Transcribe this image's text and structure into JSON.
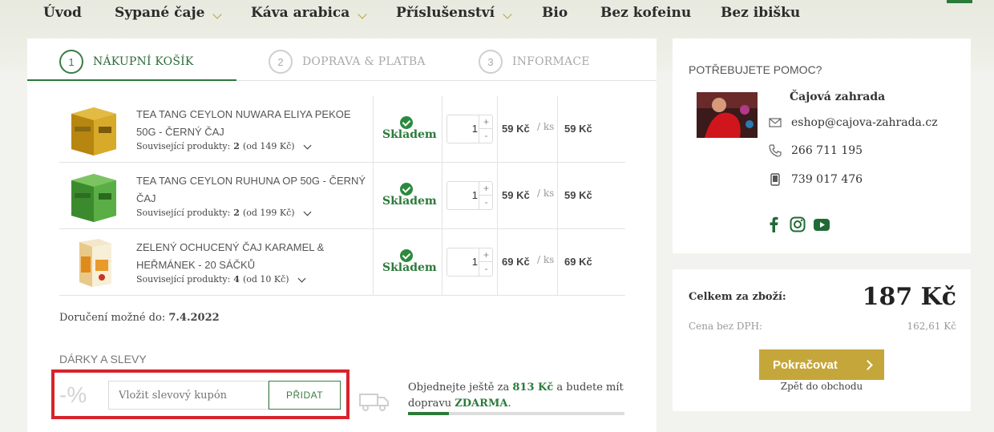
{
  "nav": {
    "items": [
      {
        "label": "Úvod",
        "has_menu": false
      },
      {
        "label": "Sypané čaje",
        "has_menu": true
      },
      {
        "label": "Káva arabica",
        "has_menu": true
      },
      {
        "label": "Příslušenství",
        "has_menu": true
      },
      {
        "label": "Bio",
        "has_menu": false
      },
      {
        "label": "Bez kofeinu",
        "has_menu": false
      },
      {
        "label": "Bez ibišku",
        "has_menu": false
      }
    ]
  },
  "steps": [
    {
      "num": "1",
      "label": "NÁKUPNÍ KOŠÍK",
      "active": true
    },
    {
      "num": "2",
      "label": "DOPRAVA & PLATBA",
      "active": false
    },
    {
      "num": "3",
      "label": "INFORMACE",
      "active": false
    }
  ],
  "cart": {
    "items": [
      {
        "name": "TEA TANG CEYLON NUWARA ELIYA PEKOE 50G - ČERNÝ ČAJ",
        "related_label": "Související produkty:",
        "related_count": "2",
        "related_from": "(od 149 Kč)",
        "stock": "Skladem",
        "qty": "1",
        "price": "59 Kč",
        "unit": "/ ks",
        "total": "59 Kč"
      },
      {
        "name": "TEA TANG CEYLON RUHUNA OP 50G - ČERNÝ ČAJ",
        "related_label": "Související produkty:",
        "related_count": "2",
        "related_from": "(od 199 Kč)",
        "stock": "Skladem",
        "qty": "1",
        "price": "59 Kč",
        "unit": "/ ks",
        "total": "59 Kč"
      },
      {
        "name": "ZELENÝ OCHUCENÝ ČAJ KARAMEL & HEŘMÁNEK - 20 SÁČKŮ",
        "related_label": "Související produkty:",
        "related_count": "4",
        "related_from": "(od 10 Kč)",
        "stock": "Skladem",
        "qty": "1",
        "price": "69 Kč",
        "unit": "/ ks",
        "total": "69 Kč"
      }
    ],
    "qty_plus": "+",
    "qty_minus": "-"
  },
  "delivery": {
    "label": "Doručení možné do:",
    "date": "7.4.2022"
  },
  "gifts": {
    "title": "DÁRKY A SLEVY",
    "percent": "-%",
    "coupon_placeholder": "Vložit slevový kupón",
    "add_label": "PŘIDAT"
  },
  "shipping": {
    "pre": "Objednejte ještě za",
    "amount": "813 Kč",
    "mid": "a budete mít dopravu",
    "free": "ZDARMA",
    "post": ".",
    "progress": 0.19
  },
  "help": {
    "title": "POTŘEBUJETE POMOC?",
    "name": "Čajová zahrada",
    "email": "eshop@cajova-zahrada.cz",
    "phone": "266 711 195",
    "mobile": "739 017 476",
    "social": [
      "facebook-icon",
      "instagram-icon",
      "youtube-icon"
    ]
  },
  "summary": {
    "total_label": "Celkem za zboží:",
    "total": "187 Kč",
    "net_label": "Cena bez DPH:",
    "net": "162,61 Kč",
    "continue_label": "Pokračovat",
    "back_label": "Zpět do obchodu"
  },
  "colors": {
    "accent_green": "#2c7a3a",
    "gold": "#c5a63a",
    "highlight_red": "#d7232c"
  }
}
